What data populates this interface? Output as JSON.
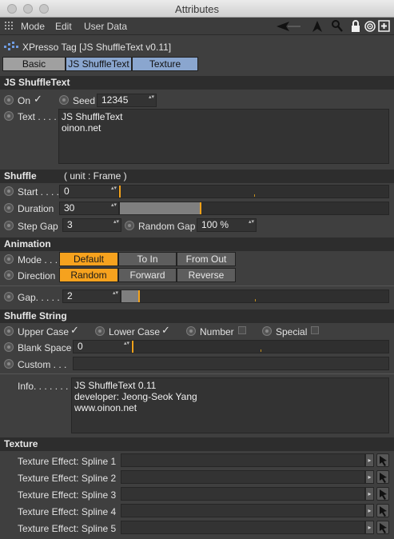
{
  "window": {
    "title": "Attributes"
  },
  "menubar": {
    "items": [
      "Mode",
      "Edit",
      "User Data"
    ]
  },
  "object": {
    "name": "XPresso Tag [JS ShuffleText v0.11]"
  },
  "tabs": [
    {
      "label": "Basic",
      "active": false
    },
    {
      "label": "JS ShuffleText",
      "active": true
    },
    {
      "label": "Texture",
      "active": true
    }
  ],
  "shuffletext": {
    "header": "JS ShuffleText",
    "on_label": "On",
    "on_checked": "✓",
    "seed_label": "Seed",
    "seed_value": "12345",
    "text_label": "Text . . . .",
    "text_lines": [
      "JS ShuffleText",
      "oinon.net"
    ]
  },
  "shuffle": {
    "header": "Shuffle",
    "unit": "( unit : Frame )",
    "start_label": "Start . . . .",
    "start_value": "0",
    "start_fraction": 0.0,
    "duration_label": "Duration",
    "duration_value": "30",
    "duration_fraction": 0.3,
    "stepgap_label": "Step Gap",
    "stepgap_value": "3",
    "randomgap_label": "Random Gap",
    "randomgap_value": "100 %"
  },
  "animation": {
    "header": "Animation",
    "mode_label": "Mode . . .",
    "mode_options": [
      "Default",
      "To In",
      "From Out"
    ],
    "mode_selected": 0,
    "direction_label": "Direction",
    "direction_options": [
      "Random",
      "Forward",
      "Reverse"
    ],
    "direction_selected": 0,
    "gap_label": "Gap. . . . .",
    "gap_value": "2",
    "gap_fraction": 0.067
  },
  "shufflestring": {
    "header": "Shuffle String",
    "upper_label": "Upper Case",
    "upper_mark": "✓",
    "lower_label": "Lower Case",
    "lower_mark": "✓",
    "number_label": "Number",
    "special_label": "Special",
    "blank_label": "Blank Space",
    "blank_value": "0",
    "blank_fraction": 0.0,
    "custom_label": "Custom . . .",
    "custom_value": ""
  },
  "info": {
    "label": "Info. . . . . . .",
    "lines": [
      "JS ShuffleText 0.11",
      "developer: Jeong-Seok Yang",
      "www.oinon.net"
    ]
  },
  "texture": {
    "header": "Texture",
    "effects": [
      {
        "label": "Texture Effect: Spline 1"
      },
      {
        "label": "Texture Effect: Spline 2"
      },
      {
        "label": "Texture Effect: Spline 3"
      },
      {
        "label": "Texture Effect: Spline 4"
      },
      {
        "label": "Texture Effect: Spline 5"
      }
    ]
  },
  "colors": {
    "accent": "#f6a21e",
    "tab_active": "#8aa6cf",
    "tab_inactive": "#a0a0a0"
  }
}
